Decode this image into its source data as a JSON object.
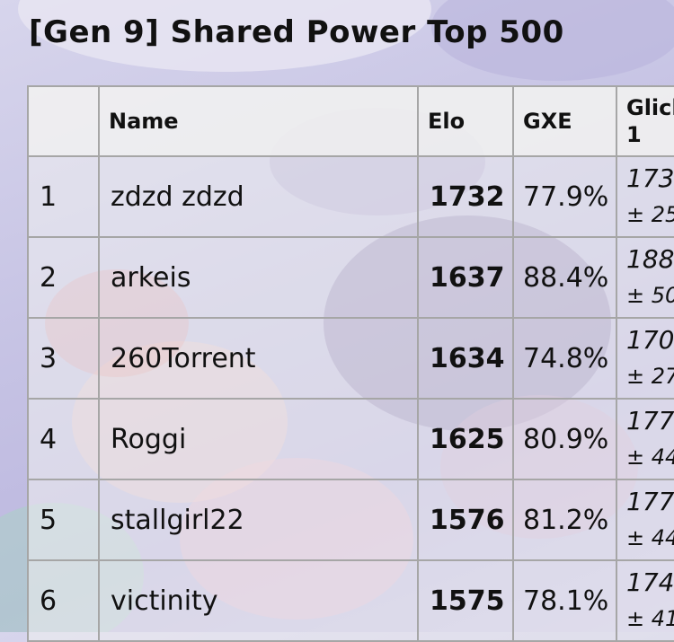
{
  "page": {
    "title": "[Gen 9] Shared Power Top 500"
  },
  "table": {
    "headers": {
      "rank": "",
      "name": "Name",
      "elo": "Elo",
      "gxe": "GXE",
      "glicko_line1": "Glick",
      "glicko_line2": "1"
    },
    "rows": [
      {
        "rank": "1",
        "name": "zdzd zdzd",
        "elo": "1732",
        "gxe": "77.9%",
        "glicko": "173",
        "glicko_dev": "± 25"
      },
      {
        "rank": "2",
        "name": "arkeis",
        "elo": "1637",
        "gxe": "88.4%",
        "glicko": "188",
        "glicko_dev": "± 50"
      },
      {
        "rank": "3",
        "name": "260Torrent",
        "elo": "1634",
        "gxe": "74.8%",
        "glicko": "170",
        "glicko_dev": "± 27"
      },
      {
        "rank": "4",
        "name": "Roggi",
        "elo": "1625",
        "gxe": "80.9%",
        "glicko": "177",
        "glicko_dev": "± 44"
      },
      {
        "rank": "5",
        "name": "stallgirl22",
        "elo": "1576",
        "gxe": "81.2%",
        "glicko": "177",
        "glicko_dev": "± 44"
      },
      {
        "rank": "6",
        "name": "victinity",
        "elo": "1575",
        "gxe": "78.1%",
        "glicko": "174",
        "glicko_dev": "± 41"
      }
    ]
  }
}
